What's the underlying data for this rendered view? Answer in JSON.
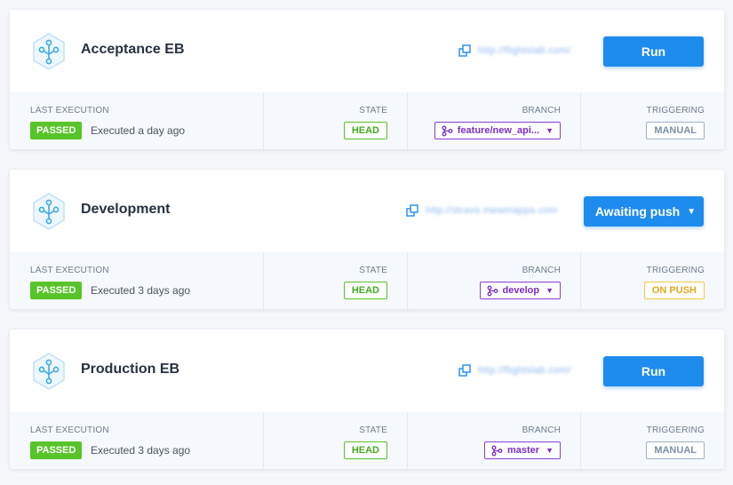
{
  "colors": {
    "primary": "#1e8bef",
    "passed": "#58c42a",
    "branch": "#7a2fc8",
    "manual": "#7d90a6",
    "on_push": "#e3a81a"
  },
  "labels": {
    "last_execution": "LAST EXECUTION",
    "state": "STATE",
    "branch": "BRANCH",
    "triggering": "TRIGGERING"
  },
  "pipelines": [
    {
      "name": "Acceptance EB",
      "url": "http://flightslab.com/",
      "action": "Run",
      "status": "PASSED",
      "executed": "Executed a day ago",
      "state": "HEAD",
      "branch": "feature/new_api...",
      "triggering": "MANUAL"
    },
    {
      "name": "Development",
      "url": "http://stravo.mewmapps.com",
      "action": "Awaiting push",
      "status": "PASSED",
      "executed": "Executed 3 days ago",
      "state": "HEAD",
      "branch": "develop",
      "triggering": "ON PUSH"
    },
    {
      "name": "Production EB",
      "url": "http://flightslab.com/",
      "action": "Run",
      "status": "PASSED",
      "executed": "Executed 3 days ago",
      "state": "HEAD",
      "branch": "master",
      "triggering": "MANUAL"
    }
  ]
}
